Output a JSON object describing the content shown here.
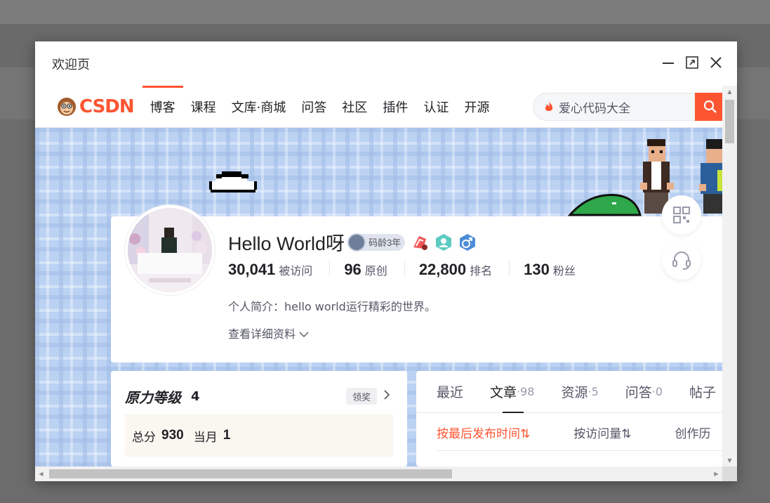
{
  "window": {
    "title": "欢迎页",
    "controls": [
      "minimize-icon",
      "maximize-icon",
      "close-icon"
    ]
  },
  "nav": {
    "logo_text": "CSDN",
    "items": [
      "博客",
      "课程",
      "文库·商城",
      "问答",
      "社区",
      "插件",
      "认证",
      "开源"
    ],
    "active_index": 0,
    "search_placeholder": "爱心代码大全"
  },
  "profile": {
    "name": "Hello World呀",
    "code_age_badge": "码龄3年",
    "stats": [
      {
        "value": "30,041",
        "label": "被访问"
      },
      {
        "value": "96",
        "label": "原创"
      },
      {
        "value": "22,800",
        "label": "排名"
      },
      {
        "value": "130",
        "label": "粉丝"
      }
    ],
    "intro_label": "个人简介：",
    "intro_value": "hello world运行精彩的世界。",
    "detail_link": "查看详细资料"
  },
  "level": {
    "title": "原力等级",
    "level": "4",
    "award_button": "领奖",
    "total_label": "总分",
    "total_value": "930",
    "month_label": "当月",
    "month_value": "1"
  },
  "content_tabs": [
    {
      "label": "最近",
      "count": ""
    },
    {
      "label": "文章",
      "count": "·98"
    },
    {
      "label": "资源",
      "count": "·5"
    },
    {
      "label": "问答",
      "count": "·0"
    },
    {
      "label": "帖子",
      "count": ""
    }
  ],
  "sort_options": [
    "按最后发布时间⇅",
    "按访问量⇅",
    "创作历"
  ],
  "colors": {
    "brand": "#fc5531",
    "banner": "#bcd2f3"
  }
}
